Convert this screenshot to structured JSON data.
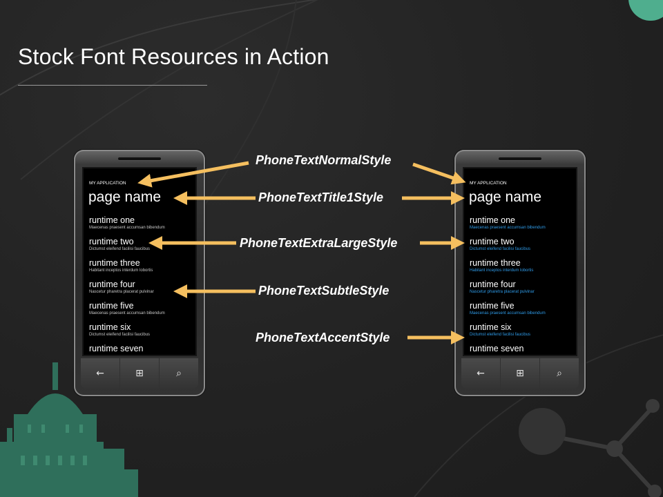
{
  "slide": {
    "title": "Stock Font Resources in Action"
  },
  "phone": {
    "app_name": "MY APPLICATION",
    "page_name": "page name",
    "items": [
      {
        "title": "runtime one",
        "subtitle": "Maecenas praesent accumsan bibendum"
      },
      {
        "title": "runtime two",
        "subtitle": "Dictumst eleifend facilisi faucibus"
      },
      {
        "title": "runtime three",
        "subtitle": "Habitant inceptos interdum lobortis"
      },
      {
        "title": "runtime four",
        "subtitle": "Nascetur pharetra placerat pulvinar"
      },
      {
        "title": "runtime five",
        "subtitle": "Maecenas praesent accumsan bibendum"
      },
      {
        "title": "runtime six",
        "subtitle": "Dictumst eleifend facilisi faucibus"
      },
      {
        "title": "runtime seven",
        "subtitle": ""
      }
    ],
    "nav": {
      "back_glyph": "←",
      "start_glyph": "⊞",
      "search_glyph": "⌕"
    }
  },
  "labels": {
    "normal": "PhoneTextNormalStyle",
    "title1": "PhoneTextTitle1Style",
    "extra_large": "PhoneTextExtraLargeStyle",
    "subtle": "PhoneTextSubtleStyle",
    "accent": "PhoneTextAccentStyle"
  },
  "colors": {
    "background": "#232323",
    "arrow": "#f5bf5f",
    "accent_text": "#2f9be8",
    "decor_green": "#3e8f75"
  }
}
